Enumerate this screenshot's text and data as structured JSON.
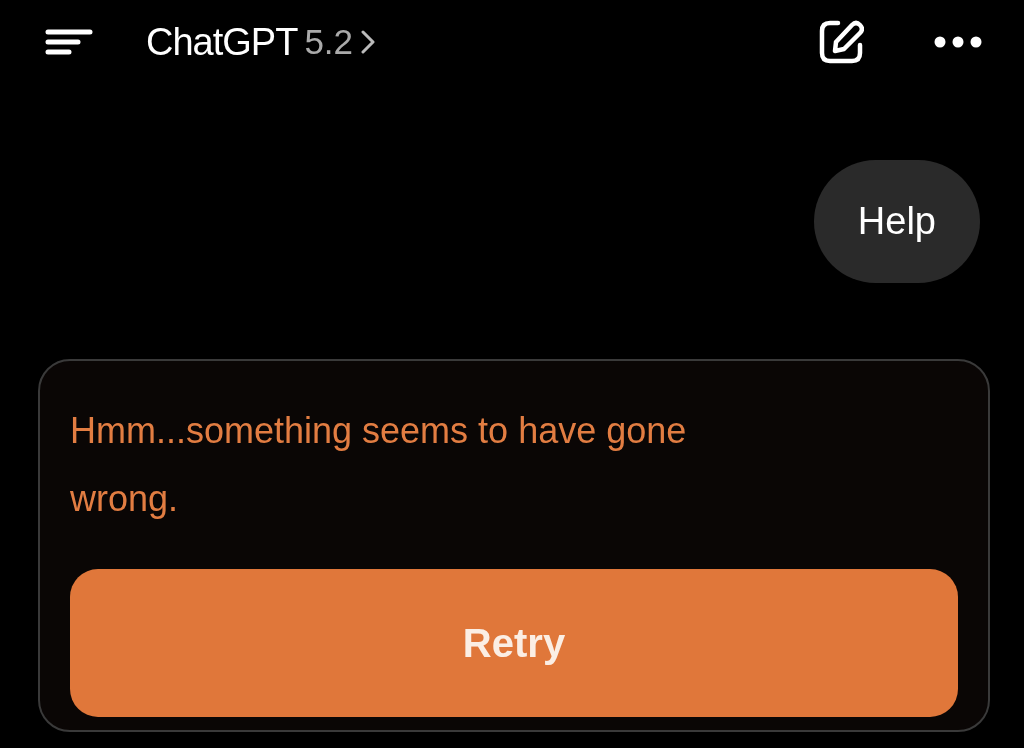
{
  "header": {
    "title": "ChatGPT",
    "version": "5.2"
  },
  "messages": [
    {
      "kind": "user",
      "text": "Help"
    },
    {
      "kind": "error",
      "text": "Hmm...something seems to have gone wrong.",
      "button": "Retry"
    }
  ]
}
